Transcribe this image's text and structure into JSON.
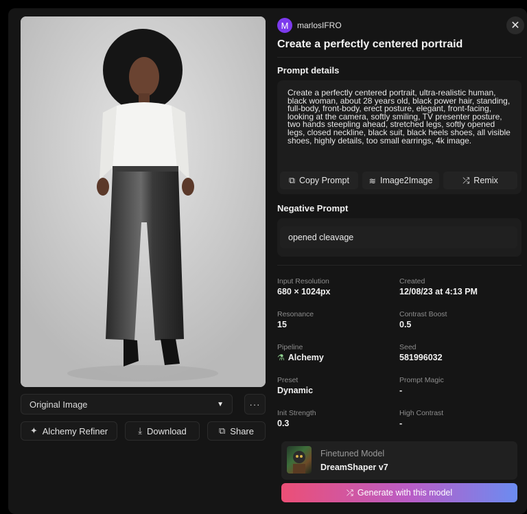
{
  "user": {
    "avatar_letter": "M",
    "name": "marlosIFRO"
  },
  "title": "Create a perfectly centered portraid",
  "prompt": {
    "section_label": "Prompt details",
    "text": "Create a perfectly centered portrait, ultra-realistic human, black woman, about 28 years old, black power hair, standing, full-body, front-body, erect posture, elegant, front-facing, looking at the camera, softly smiling, TV presenter posture, two hands steepling ahead, stretched legs, softly opened legs, closed neckline, black suit, black heels shoes, all visible shoes, highly details, too small earrings, 4k image.",
    "actions": [
      {
        "label": "Copy Prompt",
        "icon": "copy-icon",
        "glyph": "⧉"
      },
      {
        "label": "Image2Image",
        "icon": "layers-icon",
        "glyph": "≋"
      },
      {
        "label": "Remix",
        "icon": "remix-icon",
        "glyph": "⤮"
      }
    ]
  },
  "negative": {
    "section_label": "Negative Prompt",
    "text": "opened cleavage"
  },
  "meta": [
    {
      "label": "Input Resolution",
      "value": "680 × 1024px"
    },
    {
      "label": "Created",
      "value": "12/08/23 at 4:13 PM"
    },
    {
      "label": "Resonance",
      "value": "15"
    },
    {
      "label": "Contrast Boost",
      "value": "0.5"
    },
    {
      "label": "Pipeline",
      "value": "Alchemy"
    },
    {
      "label": "Seed",
      "value": "581996032"
    },
    {
      "label": "Preset",
      "value": "Dynamic"
    },
    {
      "label": "Prompt Magic",
      "value": "-"
    },
    {
      "label": "Init Strength",
      "value": "0.3"
    },
    {
      "label": "High Contrast",
      "value": "-"
    }
  ],
  "model": {
    "label": "Finetuned Model",
    "name": "DreamShaper v7"
  },
  "generate_label": "Generate with this model",
  "image_controls": {
    "variant_select": "Original Image",
    "more_glyph": "···",
    "refiner_label": "Alchemy Refiner",
    "download_label": "Download",
    "share_label": "Share"
  },
  "colors": {
    "accent_avatar": "#7c3aed",
    "generate_gradient_start": "#ec4f76",
    "generate_gradient_end": "#6b8cf1",
    "panel_bg": "#151515"
  }
}
